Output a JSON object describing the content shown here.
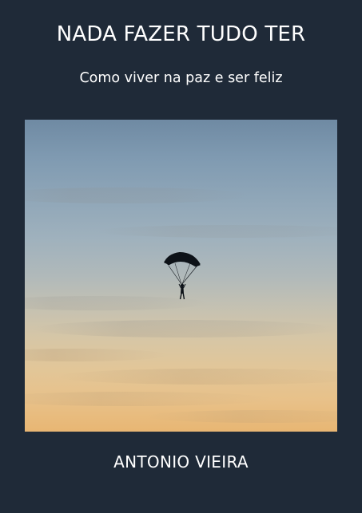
{
  "cover": {
    "title": "NADA FAZER TUDO TER",
    "subtitle": "Como viver na paz e ser feliz",
    "author": "ANTONIO VIEIRA",
    "background_color": "#1f2a38",
    "text_color": "#ffffff"
  },
  "image": {
    "subject": "parachutist-silhouette",
    "sky_colors": [
      "#6f8aa3",
      "#b0b9ba",
      "#e8b673"
    ]
  }
}
